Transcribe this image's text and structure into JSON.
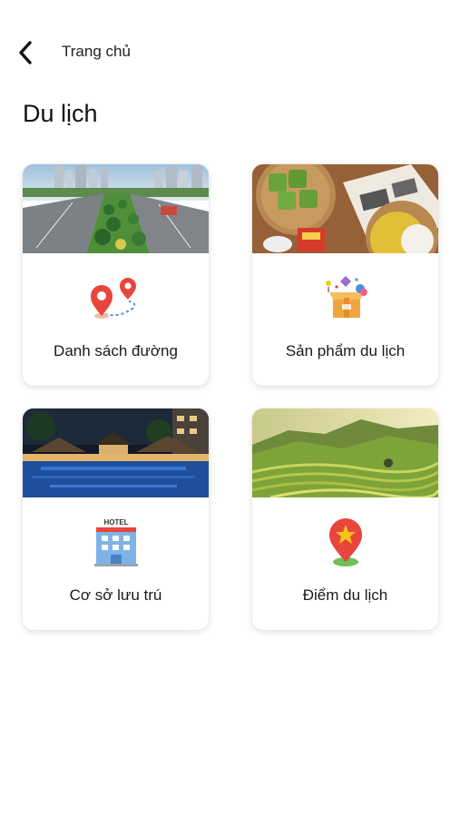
{
  "header": {
    "back_label": "Trang chủ"
  },
  "page": {
    "title": "Du lịch"
  },
  "cards": [
    {
      "label": "Danh sách đường",
      "icon": "route-pins-icon",
      "photo": "city-boulevard-photo"
    },
    {
      "label": "Sản phẩm du lịch",
      "icon": "gift-box-icon",
      "photo": "local-food-photo"
    },
    {
      "label": "Cơ sở lưu trú",
      "icon": "hotel-icon",
      "icon_text": "HOTEL",
      "photo": "resort-pool-photo"
    },
    {
      "label": "Điểm du lịch",
      "icon": "star-location-pin-icon",
      "photo": "rice-terraces-photo"
    }
  ],
  "colors": {
    "pin_red": "#e8453c",
    "accent_blue": "#4a90e2",
    "star_yellow": "#f5c518",
    "text": "#1a1a1a"
  }
}
